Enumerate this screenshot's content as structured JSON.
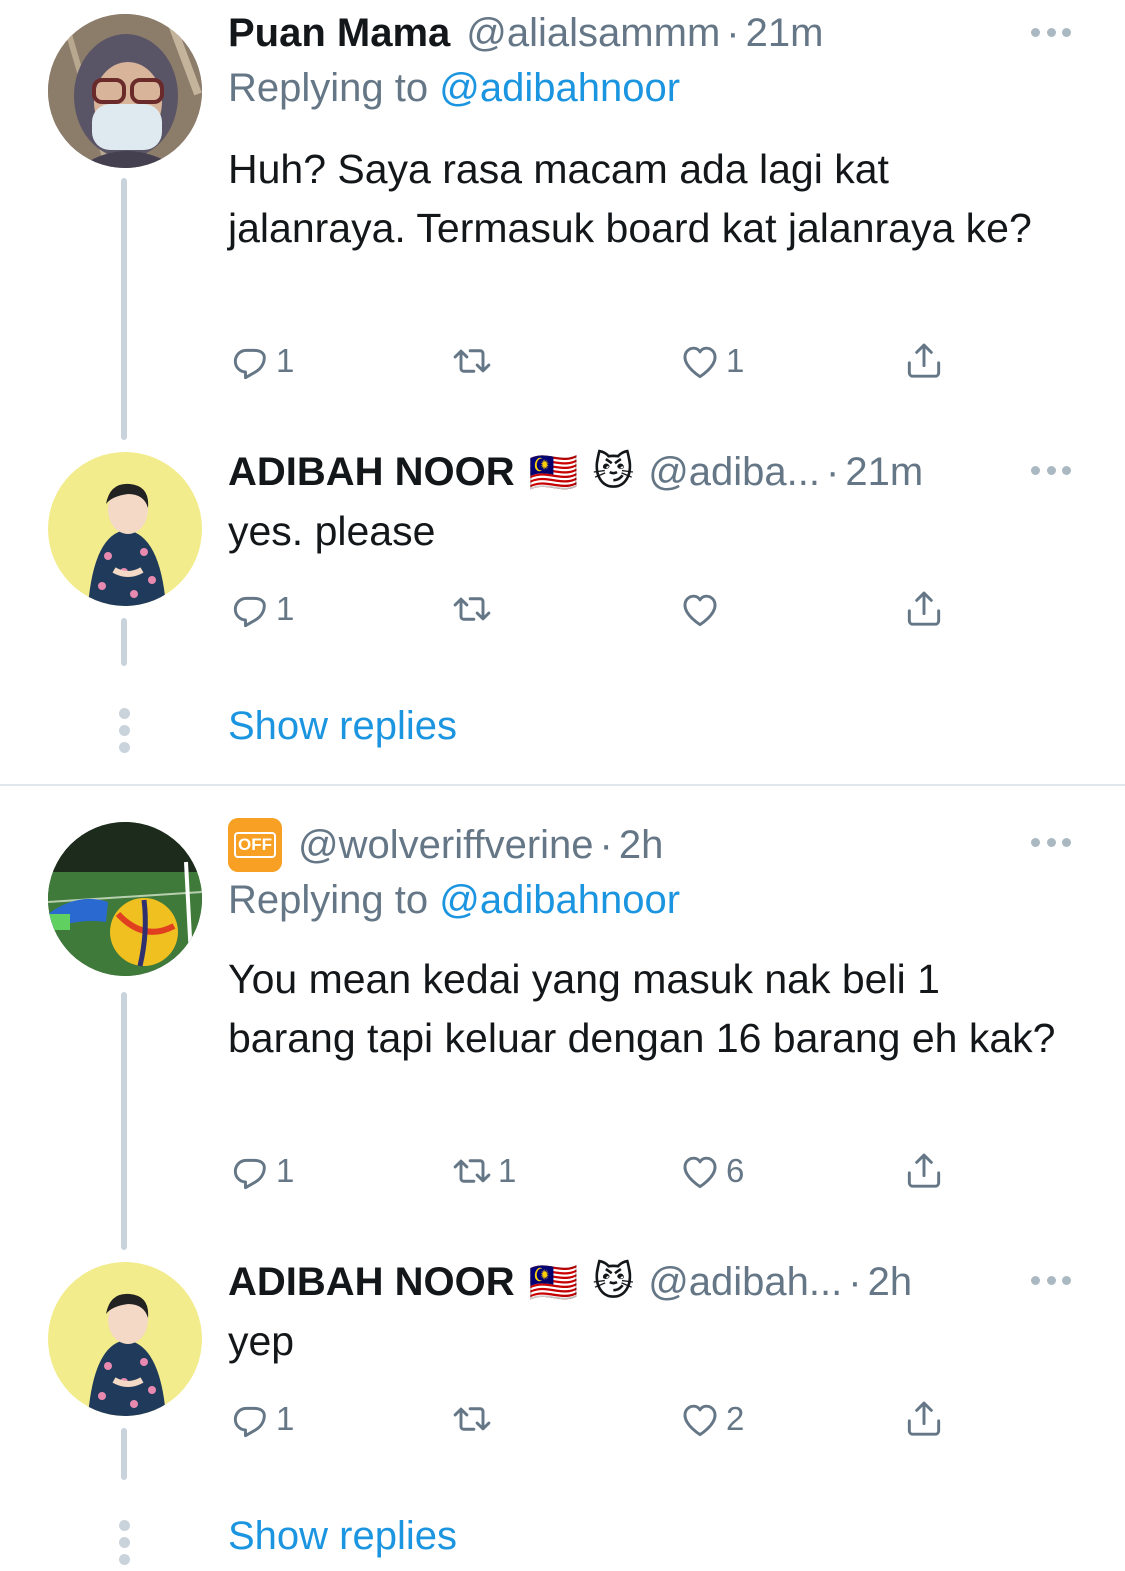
{
  "tweets": [
    {
      "name": "Puan Mama",
      "handle": "@alialsammm",
      "sep": "·",
      "time": "21m",
      "replying_prefix": "Replying to ",
      "replying_to": "@adibahnoor",
      "text": "Huh? Saya rasa macam ada lagi kat jalanraya. Termasuk board kat jalanraya ke?",
      "reply_count": "1",
      "retweet_count": "",
      "like_count": "1"
    },
    {
      "name": "ADIBAH NOOR",
      "flag_emoji": "🇲🇾",
      "cat_emoji": "😼",
      "handle": "@adiba...",
      "sep": "·",
      "time": "21m",
      "text": "yes. please",
      "reply_count": "1",
      "retweet_count": "",
      "like_count": ""
    },
    {
      "name": "",
      "off_icon_label": "OFF",
      "handle": "@wolveriffverine",
      "sep": "·",
      "time": "2h",
      "replying_prefix": "Replying to ",
      "replying_to": "@adibahnoor",
      "text": "You mean kedai yang masuk nak beli 1 barang tapi keluar dengan 16 barang eh kak?",
      "reply_count": "1",
      "retweet_count": "1",
      "like_count": "6"
    },
    {
      "name": "ADIBAH NOOR",
      "flag_emoji": "🇲🇾",
      "cat_emoji": "😼",
      "handle": "@adibah...",
      "sep": "·",
      "time": "2h",
      "text": "yep",
      "reply_count": "1",
      "retweet_count": "",
      "like_count": "2"
    }
  ],
  "show_replies_label": "Show replies",
  "colors": {
    "link": "#1b95e0",
    "muted": "#657786",
    "text": "#14171a",
    "thread_line": "#c9d3dc"
  },
  "icons": [
    "reply-icon",
    "retweet-icon",
    "like-icon",
    "share-icon",
    "more-icon",
    "off-phone-icon"
  ]
}
